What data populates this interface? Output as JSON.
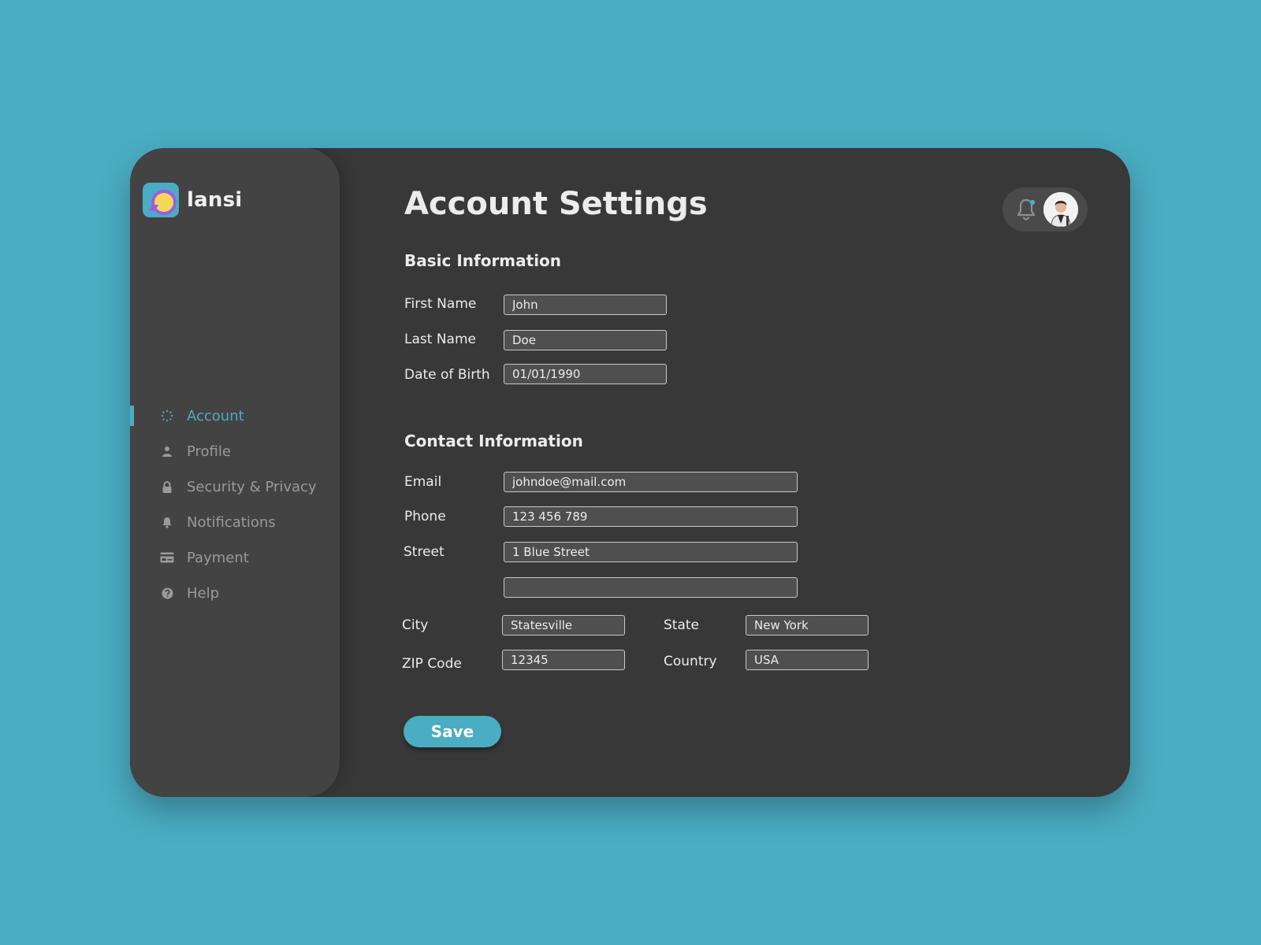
{
  "brand": {
    "name": "lansi"
  },
  "sidebar": {
    "items": [
      {
        "label": "Account",
        "icon": "spinner-icon",
        "active": true
      },
      {
        "label": "Profile",
        "icon": "user-icon",
        "active": false
      },
      {
        "label": "Security & Privacy",
        "icon": "lock-icon",
        "active": false
      },
      {
        "label": "Notifications",
        "icon": "bell-icon",
        "active": false
      },
      {
        "label": "Payment",
        "icon": "credit-card-icon",
        "active": false
      },
      {
        "label": "Help",
        "icon": "help-icon",
        "active": false
      }
    ]
  },
  "header": {
    "title": "Account Settings"
  },
  "basic": {
    "title": "Basic Information",
    "first_name": {
      "label": "First Name",
      "value": "John"
    },
    "last_name": {
      "label": "Last Name",
      "value": "Doe"
    },
    "dob": {
      "label": "Date of Birth",
      "value": "01/01/1990"
    }
  },
  "contact": {
    "title": "Contact Information",
    "email": {
      "label": "Email",
      "value": "johndoe@mail.com"
    },
    "phone": {
      "label": "Phone",
      "value": "123 456 789"
    },
    "street": {
      "label": "Street",
      "value": "1 Blue Street",
      "value2": ""
    },
    "city": {
      "label": "City",
      "value": "Statesville"
    },
    "state": {
      "label": "State",
      "value": "New York"
    },
    "zip": {
      "label": "ZIP Code",
      "value": "12345"
    },
    "country": {
      "label": "Country",
      "value": "USA"
    }
  },
  "actions": {
    "save_label": "Save"
  },
  "colors": {
    "accent": "#4aadc3",
    "background": "#4aadc3",
    "panel": "#383838",
    "sidebar": "#434343"
  }
}
